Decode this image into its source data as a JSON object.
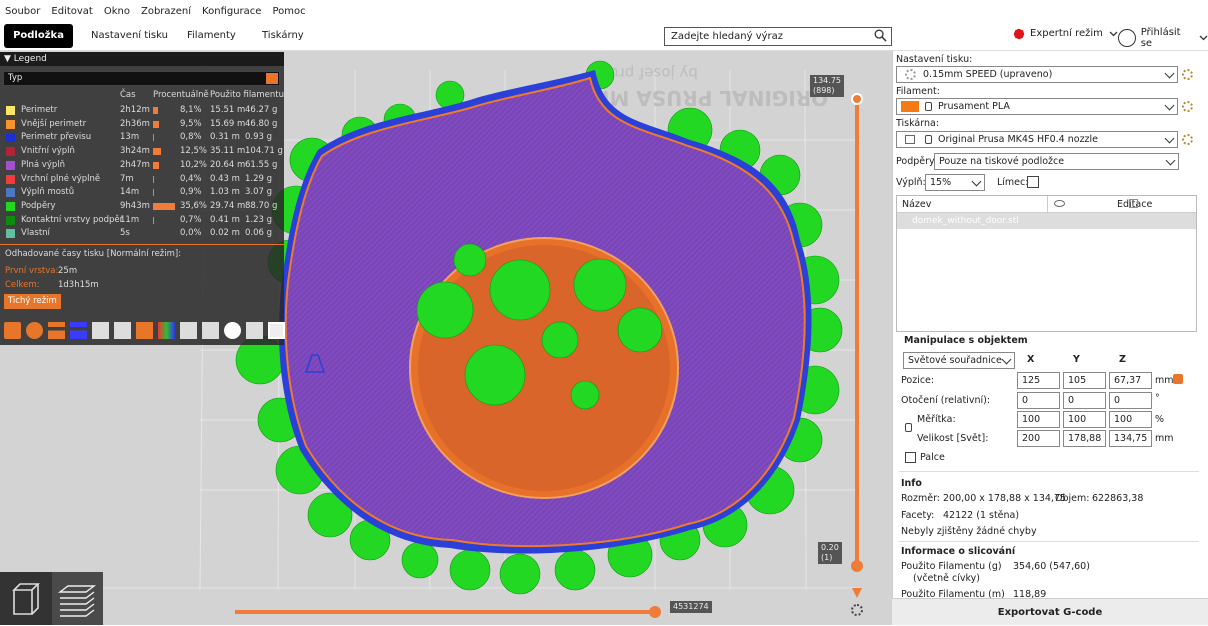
{
  "menu": [
    "Soubor",
    "Editovat",
    "Okno",
    "Zobrazení",
    "Konfigurace",
    "Pomoc"
  ],
  "tabs": [
    "Podložka",
    "Nastavení tisku",
    "Filamenty",
    "Tiskárny"
  ],
  "search_placeholder": "Zadejte hledaný výraz",
  "mode_label": "Expertní režim",
  "login_label": "Přihlásit se",
  "legend": {
    "title": "Legend",
    "view_type": "Typ",
    "headers": {
      "time": "Čas",
      "percent": "Procentuálně",
      "filament": "Použito filamentu"
    },
    "items": [
      {
        "name": "Perimetr",
        "time": "2h12m",
        "pct": "8,1%",
        "pct_val": 8.1,
        "m": "15.51 m",
        "g": "46.27 g",
        "color": "#ffe566"
      },
      {
        "name": "Vnější perimetr",
        "time": "2h36m",
        "pct": "9,5%",
        "pct_val": 9.5,
        "m": "15.69 m",
        "g": "46.80 g",
        "color": "#f7922c"
      },
      {
        "name": "Perimetr převisu",
        "time": "13m",
        "pct": "0,8%",
        "pct_val": 0.8,
        "m": "0.31 m",
        "g": "0.93 g",
        "color": "#1e2ed6"
      },
      {
        "name": "Vnitřní výplň",
        "time": "3h24m",
        "pct": "12,5%",
        "pct_val": 12.5,
        "m": "35.11 m",
        "g": "104.71 g",
        "color": "#b3233a"
      },
      {
        "name": "Plná výplň",
        "time": "2h47m",
        "pct": "10,2%",
        "pct_val": 10.2,
        "m": "20.64 m",
        "g": "61.55 g",
        "color": "#a24fd0"
      },
      {
        "name": "Vrchní plné výplně",
        "time": "7m",
        "pct": "0,4%",
        "pct_val": 0.4,
        "m": "0.43 m",
        "g": "1.29 g",
        "color": "#f03c3c"
      },
      {
        "name": "Výplň mostů",
        "time": "14m",
        "pct": "0,9%",
        "pct_val": 0.9,
        "m": "1.03 m",
        "g": "3.07 g",
        "color": "#4d78bf"
      },
      {
        "name": "Podpěry",
        "time": "9h43m",
        "pct": "35,6%",
        "pct_val": 35.6,
        "m": "29.74 m",
        "g": "88.70 g",
        "color": "#1fd81f"
      },
      {
        "name": "Kontaktní vrstvy podpěr",
        "time": "11m",
        "pct": "0,7%",
        "pct_val": 0.7,
        "m": "0.41 m",
        "g": "1.23 g",
        "color": "#0c8c0c"
      },
      {
        "name": "Vlastní",
        "time": "5s",
        "pct": "0,0%",
        "pct_val": 0.0,
        "m": "0.02 m",
        "g": "0.06 g",
        "color": "#5fbf9f"
      }
    ],
    "estimate_title": "Odhadované časy tisku [Normální režim]:",
    "first_layer_label": "První vrstva:",
    "first_layer": "25m",
    "total_label": "Celkem:",
    "total": "1d3h15m",
    "quiet_mode": "Tichý režim"
  },
  "bed_text": "ORIGINAL PRUSA MK4",
  "bed_text2": "by josef prusa",
  "vslider": {
    "top_value": "134.75",
    "top_layer": "(898)",
    "bottom_value": "0.20",
    "bottom_layer": "(1)"
  },
  "hslider_value": "4531274",
  "right": {
    "print_settings_label": "Nastavení tisku:",
    "print_settings": "0.15mm SPEED (upraveno)",
    "filament_label": "Filament:",
    "filament": "Prusament PLA",
    "filament_color": "#f47a15",
    "printer_label": "Tiskárna:",
    "printer": "Original Prusa MK4S HF0.4 nozzle",
    "supports_label": "Podpěry:",
    "supports": "Pouze na tiskové podložce",
    "infill_label": "Výplň:",
    "infill": "15%",
    "brim_label": "Límec:",
    "list_name_header": "Název",
    "list_edit_header": "Editace",
    "object_name": "domek_without_door.stl",
    "manip_title": "Manipulace s objektem",
    "coords": "Světové souřadnice",
    "x": "X",
    "y": "Y",
    "z": "Z",
    "position_label": "Pozice:",
    "position": [
      "125",
      "105",
      "67,37"
    ],
    "rotation_label": "Otočení (relativní):",
    "rotation": [
      "0",
      "0",
      "0"
    ],
    "scale_label": "Měřítka:",
    "scale": [
      "100",
      "100",
      "100"
    ],
    "size_label": "Velikost [Svět]:",
    "size": [
      "200",
      "178,88",
      "134,75"
    ],
    "unit_mm": "mm",
    "unit_deg": "°",
    "unit_pct": "%",
    "inches_label": "Palce",
    "info_title": "Info",
    "size_info_label": "Rozměr:",
    "size_info": "200,00 x 178,88 x 134,75",
    "volume_label": "Objem:",
    "volume": "622863,38",
    "facets_label": "Facety:",
    "facets": "42122 (1 stěna)",
    "errors": "Nebyly zjištěny žádné chyby",
    "slicing_title": "Informace o slicování",
    "filament_g_label": "Použito Filamentu (g)",
    "filament_g_sub": "(včetně cívky)",
    "filament_g": "354,60 (547,60)",
    "filament_m_label": "Použito Filamentu (m)",
    "filament_m": "118,89",
    "export": "Exportovat G-code"
  }
}
